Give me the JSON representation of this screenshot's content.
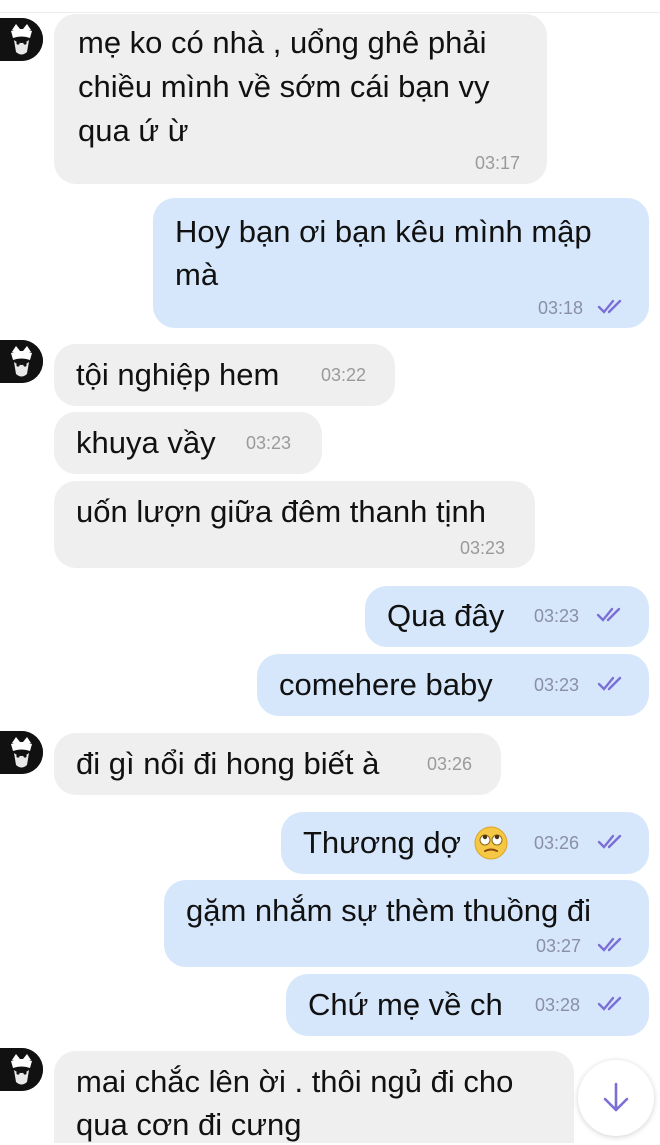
{
  "colors": {
    "incoming_bubble": "#efefef",
    "outgoing_bubble": "#d6e7fb",
    "read_check": "#7b6fd6"
  },
  "messages": [
    {
      "text_lines": [
        "mẹ ko có nhà , uổng ghê phải",
        "chiều mình về sớm cái bạn vy",
        "qua ứ ừ"
      ],
      "time": "03:17",
      "direction": "in"
    },
    {
      "text_lines": [
        "Hoy bạn ơi bạn kêu mình mập",
        "mà"
      ],
      "time": "03:18",
      "direction": "out",
      "status": "read"
    },
    {
      "text": "tội nghiệp hem",
      "time": "03:22",
      "direction": "in"
    },
    {
      "text": "khuya vầy",
      "time": "03:23",
      "direction": "in"
    },
    {
      "text": "uốn lượn giữa đêm thanh tịnh",
      "time": "03:23",
      "direction": "in"
    },
    {
      "text": "Qua đây",
      "time": "03:23",
      "direction": "out",
      "status": "read"
    },
    {
      "text": "comehere baby",
      "time": "03:23",
      "direction": "out",
      "status": "read"
    },
    {
      "text": "đi gì nổi đi hong biết à",
      "time": "03:26",
      "direction": "in"
    },
    {
      "text": "Thương dợ",
      "emoji": "rolling-eyes-emoji",
      "time": "03:26",
      "direction": "out",
      "status": "read"
    },
    {
      "text": "gặm nhắm sự thèm thuồng đi",
      "time": "03:27",
      "direction": "out",
      "status": "read"
    },
    {
      "text": "Chứ mẹ về ch",
      "time": "03:28",
      "direction": "out",
      "status": "read"
    },
    {
      "text_lines": [
        "mai chắc lên ời . thôi ngủ đi cho",
        "qua cơn đi cưng"
      ],
      "direction": "in"
    }
  ],
  "icons": {
    "avatar": "masked-cat-avatar-icon",
    "read": "double-check-icon",
    "scroll": "arrow-down-icon"
  }
}
